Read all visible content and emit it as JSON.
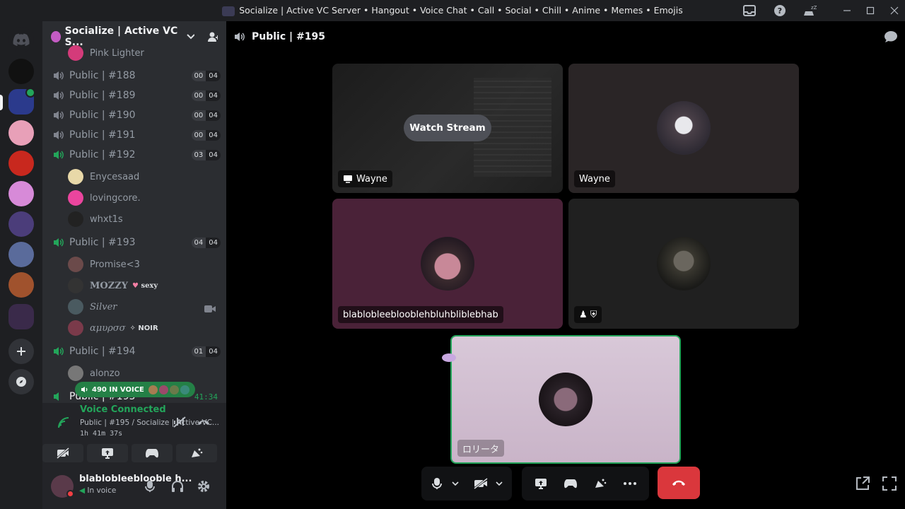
{
  "window": {
    "title": "Socialize | Active VC Server • Hangout • Voice Chat • Call • Social • Chill • Anime • Memes • Emojis"
  },
  "server": {
    "name": "Socialize | Active VC S..."
  },
  "channels": {
    "partial_user": "Pink Lighter",
    "items": [
      {
        "name": "Public | #188",
        "left": "00",
        "right": "04"
      },
      {
        "name": "Public | #189",
        "left": "00",
        "right": "04"
      },
      {
        "name": "Public | #190",
        "left": "00",
        "right": "04"
      },
      {
        "name": "Public | #191",
        "left": "00",
        "right": "04"
      },
      {
        "name": "Public | #192",
        "left": "03",
        "right": "04"
      },
      {
        "name": "Public | #193",
        "left": "04",
        "right": "04"
      },
      {
        "name": "Public | #194",
        "left": "01",
        "right": "04"
      },
      {
        "name": "Public | #195",
        "right": "41:34"
      }
    ],
    "users_192": [
      "Enycesaad",
      "lovingcore.",
      "whxt1s"
    ],
    "users_193": [
      "Promise<3",
      "MOZZY",
      "Silver",
      "αμυρσσ"
    ],
    "tags_193": {
      "mozzy": "sexy",
      "amypso": "NOIR"
    },
    "users_194": [
      "alonzo"
    ]
  },
  "in_voice_pill": "490 IN VOICE",
  "voice_panel": {
    "title": "Voice Connected",
    "subtitle": "Public | #195 / Socialize | Active VC...",
    "time": "1h 41m 37s"
  },
  "user_panel": {
    "name": "blablobleeblooble h...",
    "status": "In voice"
  },
  "main": {
    "header": "Public | #195",
    "tiles": [
      {
        "label": "Wayne",
        "watch": "Watch Stream"
      },
      {
        "label": "Wayne"
      },
      {
        "label": "blablobleeblooblehbluhbliblebhab"
      },
      {
        "label": "⛨"
      },
      {
        "label": "ロリータ"
      }
    ]
  },
  "colors": {
    "accent_green": "#23a55a",
    "hangup_red": "#da373c",
    "bg_sidebar": "#2b2d31",
    "bg_guilds": "#1e1f22"
  }
}
